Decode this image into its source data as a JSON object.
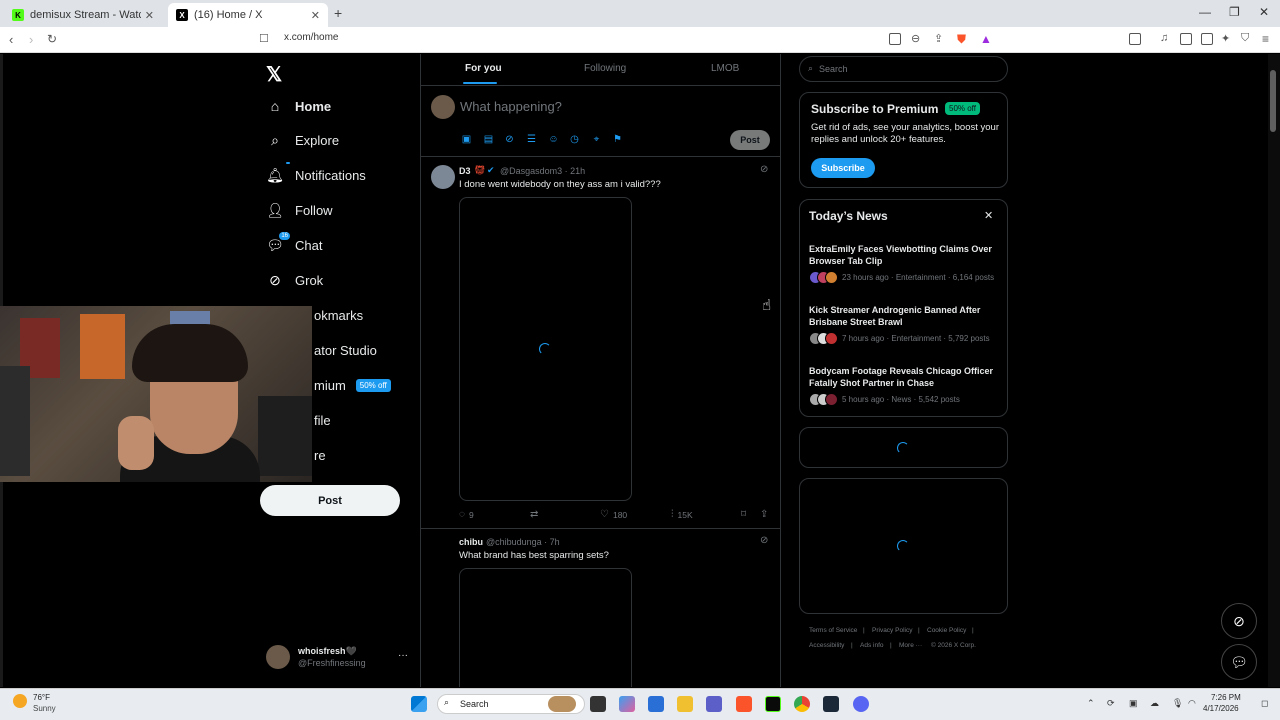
{
  "browser": {
    "tabs": [
      {
        "title": "demisux Stream - Watch Live on",
        "icon": "kick-icon"
      },
      {
        "title": "(16) Home / X",
        "icon": "x-icon"
      }
    ],
    "url": "x.com/home"
  },
  "sidebar": {
    "items": [
      {
        "label": "Home",
        "icon": "home-icon"
      },
      {
        "label": "Explore",
        "icon": "search-icon"
      },
      {
        "label": "Notifications",
        "icon": "bell-icon"
      },
      {
        "label": "Follow",
        "icon": "person-plus-icon"
      },
      {
        "label": "Chat",
        "icon": "chat-icon",
        "badge": "16"
      },
      {
        "label": "Grok",
        "icon": "grok-icon"
      },
      {
        "label": "okmarks",
        "icon": "bookmark-icon"
      },
      {
        "label": "ator Studio",
        "icon": "studio-icon"
      },
      {
        "label": "mium",
        "icon": "premium-icon",
        "pill": "50% off"
      },
      {
        "label": "file",
        "icon": "profile-icon"
      },
      {
        "label": "re",
        "icon": "more-icon"
      }
    ],
    "post_label": "Post",
    "account": {
      "name": "whoisfresh🖤",
      "handle": "@Freshfinessing"
    }
  },
  "feed": {
    "tabs": [
      "For you",
      "Following",
      "LMOB"
    ],
    "compose_placeholder": "What happening?",
    "compose_post": "Post",
    "tweets": [
      {
        "name": "D3",
        "handle": "@Dasgasdom3 · 21h",
        "text": "I done went widebody on they ass am i valid???",
        "replies": "9",
        "likes": "180",
        "views": "15K"
      },
      {
        "name": "chibu",
        "handle": "@chibudunga · 7h",
        "text": "What brand  has best sparring sets?"
      }
    ]
  },
  "right": {
    "search_placeholder": "Search",
    "premium": {
      "title": "Subscribe to Premium",
      "pill": "50% off",
      "text": "Get rid of ads, see your analytics, boost your replies and unlock 20+ features.",
      "button": "Subscribe"
    },
    "news": {
      "title": "Today’s News",
      "items": [
        {
          "headline": "ExtraEmily Faces Viewbotting Claims Over Browser Tab Clip",
          "meta": "23 hours ago · Entertainment · 6,164 posts"
        },
        {
          "headline": "Kick Streamer Androgenic Banned After Brisbane Street Brawl",
          "meta": "7 hours ago · Entertainment · 5,792 posts"
        },
        {
          "headline": "Bodycam Footage Reveals Chicago Officer Fatally Shot Partner in Chase",
          "meta": "5 hours ago · News · 5,542 posts"
        }
      ]
    },
    "footer": [
      "Terms of Service",
      "Privacy Policy",
      "Cookie Policy",
      "Accessibility",
      "Ads info",
      "More ···",
      "© 2026 X Corp."
    ]
  },
  "taskbar": {
    "weather_temp": "76°F",
    "weather_desc": "Sunny",
    "search_label": "Search",
    "time": "7:26 PM",
    "date": "4/17/2026"
  },
  "colors": {
    "accent": "#1d9bf0",
    "bg": "#000000",
    "border": "#2f3336",
    "muted": "#71767b",
    "green": "#00ba7c"
  }
}
